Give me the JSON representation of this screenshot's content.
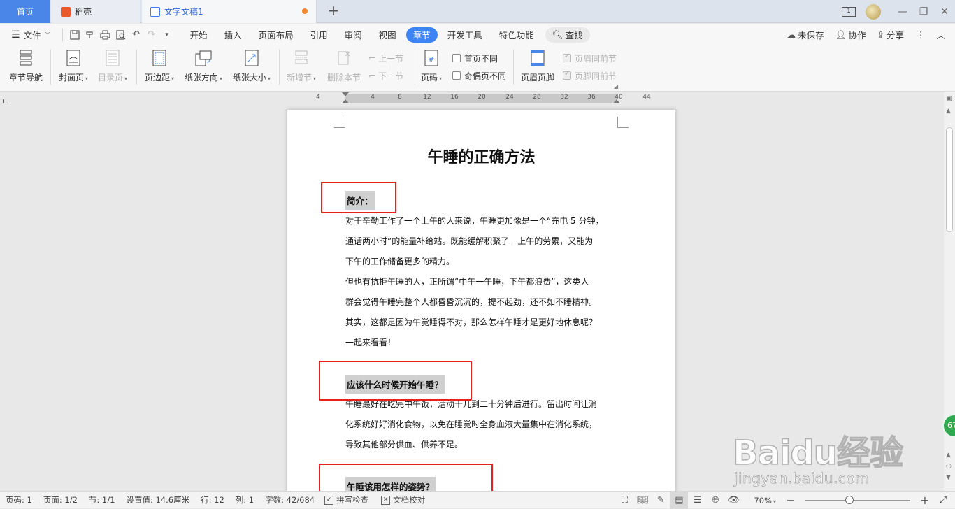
{
  "tabs": {
    "home": "首页",
    "daoke": "稻壳",
    "doc": "文字文稿1",
    "add": "+"
  },
  "window": {
    "page_indicator": "1"
  },
  "menu": {
    "file": "文件",
    "items": [
      "开始",
      "插入",
      "页面布局",
      "引用",
      "审阅",
      "视图",
      "章节",
      "开发工具",
      "特色功能"
    ],
    "active": "章节",
    "search": "查找",
    "right": {
      "unsaved": "未保存",
      "collab": "协作",
      "share": "分享"
    }
  },
  "ribbon": {
    "chapter_nav": "章节导航",
    "cover": "封面页",
    "toc": "目录页",
    "margin": "页边距",
    "orientation": "纸张方向",
    "size": "纸张大小",
    "new_section": "新增节",
    "delete_section": "删除本节",
    "prev_section": "上一节",
    "next_section": "下一节",
    "page_number": "页码",
    "first_page_diff": "首页不同",
    "odd_even_diff": "奇偶页不同",
    "header_footer": "页眉页脚",
    "header_same_prev": "页眉同前节",
    "footer_same_prev": "页脚同前节"
  },
  "ruler": {
    "ticks": [
      "4",
      "4",
      "8",
      "12",
      "16",
      "20",
      "24",
      "28",
      "32",
      "36",
      "40",
      "44"
    ]
  },
  "document": {
    "title": "午睡的正确方法",
    "sections": [
      {
        "heading": "简介：",
        "lines": [
          "对于辛勤工作了一个上午的人来说，午睡更加像是一个“充电 5 分钟，",
          "通话两小时”的能量补给站。既能缓解积聚了一上午的劳累，又能为",
          "下午的工作储备更多的精力。",
          "但也有抗拒午睡的人，正所谓“中午一午睡，下午都浪费”，这类人",
          "群会觉得午睡完整个人都昏昏沉沉的，提不起劲，还不如不睡精神。",
          "其实，这都是因为午觉睡得不对，那么怎样午睡才是更好地休息呢？",
          "一起来看看！"
        ]
      },
      {
        "heading": "应该什么时候开始午睡？",
        "lines": [
          "午睡最好在吃完中午饭，活动十几到二十分钟后进行。留出时间让消",
          "化系统好好消化食物，以免在睡觉时全身血液大量集中在消化系统，",
          "导致其他部分供血、供养不足。"
        ]
      },
      {
        "heading": "午睡该用怎样的姿势？",
        "lines": []
      }
    ]
  },
  "side_badge": "67",
  "watermark": {
    "logo": "Baidu经验",
    "url": "jingyan.baidu.com"
  },
  "status": {
    "page_code": "页码: 1",
    "pages": "页面: 1/2",
    "section": "节: 1/1",
    "setting": "设置值: 14.6厘米",
    "row": "行: 12",
    "col": "列: 1",
    "word_count": "字数: 42/684",
    "spell_check": "拼写检查",
    "doc_proof": "文档校对",
    "zoom": "70%",
    "zoom_fraction": 0.42
  },
  "colors": {
    "accent": "#3f84f5",
    "home_tab": "#4a86e8",
    "annotation_red": "#e8201c",
    "heading_highlight": "#d0d0d0"
  }
}
